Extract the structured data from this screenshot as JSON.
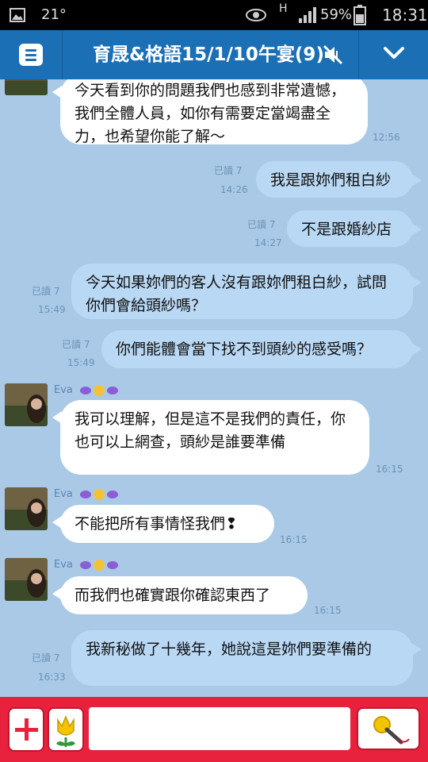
{
  "status_bar": {
    "temperature": "21°",
    "network": "H",
    "battery": "59%",
    "time": "18:31"
  },
  "header": {
    "title": "育晟&格語15/1/10午宴(9)"
  },
  "messages": [
    {
      "side": "in",
      "text": "今天看到你的問題我們也感到非常遺憾，我們全體人員，如你有需要定當竭盡全力，也希望你能了解～",
      "time": "12:56"
    },
    {
      "side": "out",
      "text": "我是跟妳們租白紗",
      "read": "已讀 7",
      "time": "14:26"
    },
    {
      "side": "out",
      "text": "不是跟婚紗店",
      "read": "已讀 7",
      "time": "14:27"
    },
    {
      "side": "out",
      "text": "今天如果妳們的客人沒有跟妳們租白紗，試問你們會給頭紗嗎？",
      "read": "已讀 7",
      "time": "15:49"
    },
    {
      "side": "out",
      "text": "你們能體會當下找不到頭紗的感受嗎？",
      "read": "已讀 7",
      "time": "15:49"
    },
    {
      "side": "in",
      "sender": "Eva",
      "text": "我可以理解，但是這不是我們的責任，你也可以上網查，頭紗是誰要準備",
      "time": "16:15"
    },
    {
      "side": "in",
      "sender": "Eva",
      "text": "不能把所有事情怪我們❢",
      "time": "16:15"
    },
    {
      "side": "in",
      "sender": "Eva",
      "text": "而我們也確實跟你確認東西了",
      "time": "16:15"
    },
    {
      "side": "out",
      "text": "我新秘做了十幾年，她說這是妳們要準備的",
      "read": "已讀 7",
      "time": "16:33"
    }
  ],
  "composer": {
    "placeholder": ""
  },
  "colors": {
    "header": "#1b6fb5",
    "background": "#a9c9e6",
    "outgoing_bubble": "#b9d8f4",
    "incoming_bubble": "#ffffff",
    "bottom_bar": "#e8223d"
  },
  "icons": [
    "picture-icon",
    "eye-icon",
    "signal-icon",
    "battery-icon",
    "menu-icon",
    "mute-icon",
    "chevron-down-icon",
    "plus-icon",
    "flower-icon",
    "microphone-icon"
  ]
}
